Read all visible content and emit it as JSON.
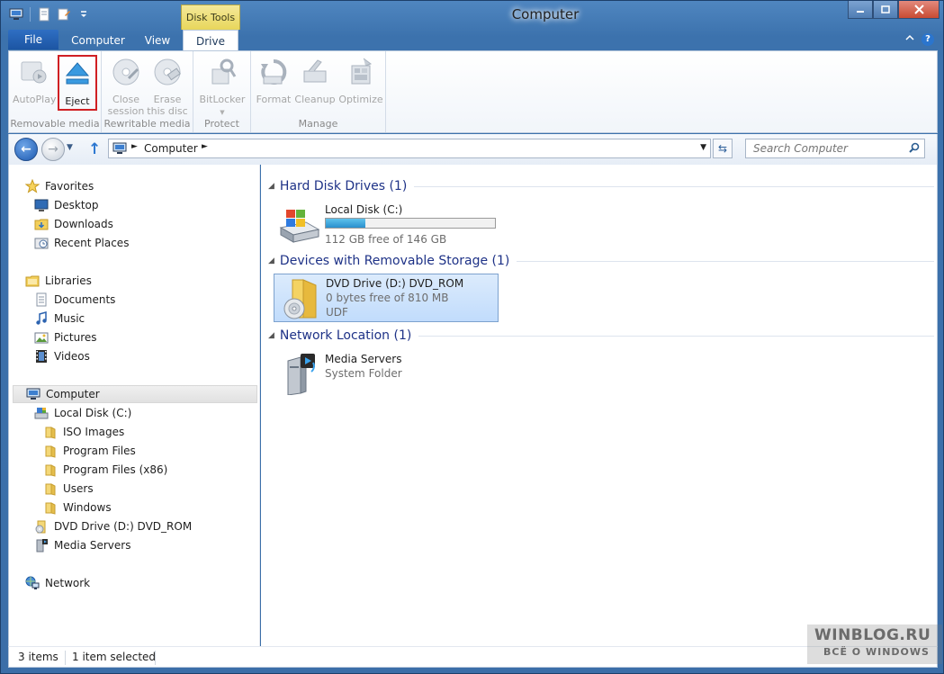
{
  "window": {
    "title": "Computer",
    "contextual_tab": "Disk Tools"
  },
  "tabs": {
    "file": "File",
    "computer": "Computer",
    "view": "View",
    "drive": "Drive",
    "help": "?"
  },
  "ribbon": {
    "groups": [
      {
        "label": "Removable media",
        "buttons": [
          "AutoPlay",
          "Eject"
        ]
      },
      {
        "label": "Rewritable media",
        "buttons": [
          [
            "Close",
            "session"
          ],
          [
            "Erase",
            "this disc"
          ]
        ]
      },
      {
        "label": "Protect",
        "buttons": [
          "BitLocker"
        ]
      },
      {
        "label": "Manage",
        "buttons": [
          "Format",
          "Cleanup",
          "Optimize"
        ]
      }
    ],
    "autoplay": "AutoPlay",
    "eject": "Eject",
    "close_l1": "Close",
    "close_l2": "session",
    "erase_l1": "Erase",
    "erase_l2": "this disc",
    "bitlocker": "BitLocker",
    "format": "Format",
    "cleanup": "Cleanup",
    "optimize": "Optimize",
    "group_removable": "Removable media",
    "group_rewritable": "Rewritable media",
    "group_protect": "Protect",
    "group_manage": "Manage"
  },
  "address": {
    "crumb": "Computer",
    "search_placeholder": "Search Computer"
  },
  "nav": {
    "favorites": "Favorites",
    "desktop": "Desktop",
    "downloads": "Downloads",
    "recent": "Recent Places",
    "libraries": "Libraries",
    "documents": "Documents",
    "music": "Music",
    "pictures": "Pictures",
    "videos": "Videos",
    "computer": "Computer",
    "local_disk": "Local Disk (C:)",
    "iso": "ISO Images",
    "program_files": "Program Files",
    "program_files_x86": "Program Files (x86)",
    "users": "Users",
    "windows": "Windows",
    "dvd": "DVD Drive (D:) DVD_ROM",
    "media_servers": "Media Servers",
    "network": "Network"
  },
  "main": {
    "group_hdd": "Hard Disk Drives (1)",
    "group_removable": "Devices with Removable Storage (1)",
    "group_network": "Network Location (1)",
    "local_disk_name": "Local Disk (C:)",
    "local_disk_free": "112 GB free of 146 GB",
    "local_disk_used_fraction": 0.233,
    "dvd_name": "DVD Drive (D:) DVD_ROM",
    "dvd_free": "0 bytes free of 810 MB",
    "dvd_fs": "UDF",
    "media_name": "Media Servers",
    "media_sub": "System Folder"
  },
  "status": {
    "items": "3 items",
    "selected": "1 item selected"
  },
  "watermark": {
    "line1": "WINBLOG.RU",
    "line2": "ВСЁ О WINDOWS"
  }
}
